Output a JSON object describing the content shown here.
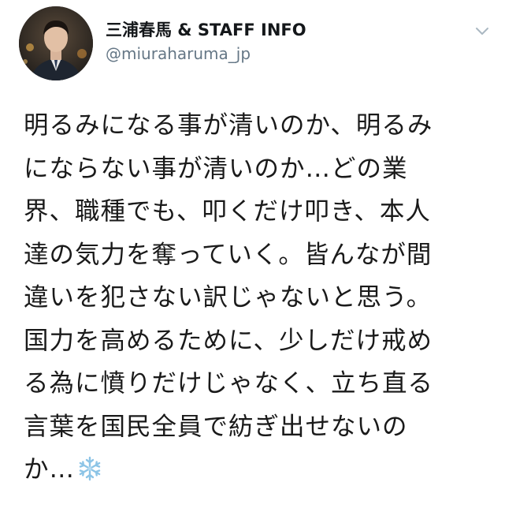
{
  "user": {
    "display_name": "三浦春馬 & STAFF INFO",
    "handle": "@miuraharuma_jp",
    "avatar_icon": "profile-photo-avatar"
  },
  "header": {
    "more_icon": "chevron-down-icon"
  },
  "tweet": {
    "lines": [
      "明るみになる事が清いのか、明るみ",
      "にならない事が清いのか…どの業",
      "界、職種でも、叩くだけ叩き、本人",
      "達の気力を奪っていく。皆んなが間",
      "違いを犯さない訳じゃないと思う。",
      "国力を高めるために、少しだけ戒め",
      "る為に憤りだけじゃなく、立ち直る",
      "言葉を国民全員で紡ぎ出せないの",
      "か…"
    ],
    "trailing_emoji": "snowflake-icon"
  },
  "colors": {
    "text": "#14171a",
    "secondary_text": "#657786",
    "snowflake": "#8cc4e6",
    "background": "#ffffff"
  }
}
